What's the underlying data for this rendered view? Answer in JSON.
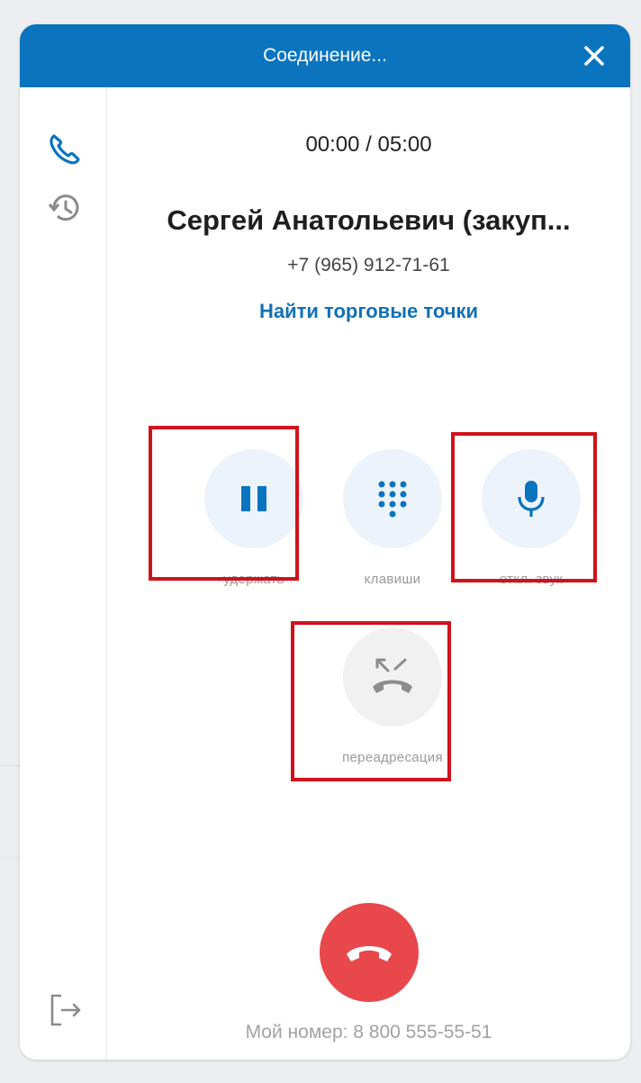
{
  "header": {
    "title": "Соединение..."
  },
  "call": {
    "timer": "00:00 / 05:00",
    "contact_name": "Сергей Анатольевич (закуп...",
    "contact_phone": "+7 (965) 912-71-61",
    "find_link": "Найти торговые точки"
  },
  "actions": {
    "hold_label": "удержать",
    "keypad_label": "клавиши",
    "mute_label": "откл. звук",
    "transfer_label": "переадресация"
  },
  "footer": {
    "my_number": "Мой номер: 8 800 555-55-51"
  },
  "icons": {
    "close": "close-icon",
    "phone": "phone-icon",
    "history": "history-icon",
    "logout": "logout-icon",
    "pause": "pause-icon",
    "keypad": "keypad-icon",
    "microphone": "microphone-icon",
    "transfer": "call-transfer-icon",
    "hangup": "hangup-icon"
  },
  "colors": {
    "header": "#0a74bf",
    "accent": "#1271b5",
    "hangup": "#e8474b",
    "highlight": "#d0121b",
    "action_bg": "#edf3fa"
  }
}
